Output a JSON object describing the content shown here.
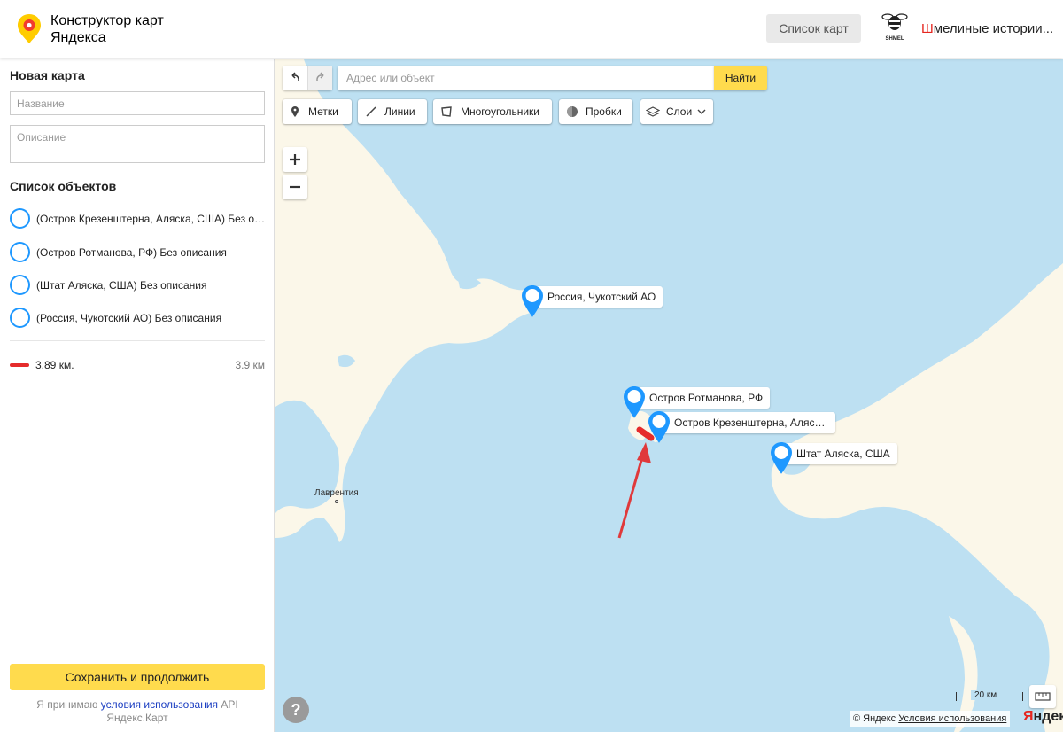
{
  "header": {
    "title": "Конструктор карт Яндекса",
    "maps_list_label": "Список карт",
    "user_name_first_letter": "Ш",
    "user_name_rest": "мелиные истории...",
    "avatar_caption": "SHMEL"
  },
  "sidebar": {
    "new_map_heading": "Новая карта",
    "name_placeholder": "Название",
    "description_placeholder": "Описание",
    "objects_heading": "Список объектов",
    "objects": [
      {
        "label": "(Остров Крезенштерна, Аляска, США) Без описания",
        "icon": "placemark-circle-icon"
      },
      {
        "label": "(Остров Ротманова, РФ) Без описания",
        "icon": "placemark-circle-icon"
      },
      {
        "label": "(Штат Аляска, США) Без описания",
        "icon": "placemark-circle-icon"
      },
      {
        "label": "(Россия, Чукотский АО) Без описания",
        "icon": "placemark-circle-icon"
      }
    ],
    "line_object": {
      "label": "3,89 км.",
      "distance": "3.9 км",
      "color": "#e52b2b"
    },
    "save_label": "Сохранить и продолжить",
    "terms_prefix": "Я принимаю",
    "terms_link": "условия использования",
    "terms_suffix": "API Яндекс.Карт"
  },
  "map": {
    "search_placeholder": "Адрес или объект",
    "search_button": "Найти",
    "tools": [
      {
        "label": "Метки",
        "icon": "placemark-tool-icon"
      },
      {
        "label": "Линии",
        "icon": "line-tool-icon"
      },
      {
        "label": "Многоугольники",
        "icon": "polygon-tool-icon"
      },
      {
        "label": "Пробки",
        "icon": "traffic-icon"
      },
      {
        "label": "Слои",
        "icon": "layers-icon"
      }
    ],
    "placemarks": [
      {
        "label": "Россия, Чукотский АО"
      },
      {
        "label": "Остров Ротманова, РФ"
      },
      {
        "label": "Остров Крезенштерна, Аляска, США"
      },
      {
        "label": "Штат Аляска, США"
      }
    ],
    "place_label": "Лаврентия",
    "scale_label": "20 км",
    "copyright_text": "© Яндекс",
    "copyright_link": "Условия использования",
    "logo_text_red": "Я",
    "logo_text_rest": "ндекс",
    "colors": {
      "water": "#bde0f2",
      "land": "#fbf7e9",
      "accent": "#ffdb4d",
      "placemark": "#1e98ff",
      "arrow": "#e0393b"
    }
  }
}
